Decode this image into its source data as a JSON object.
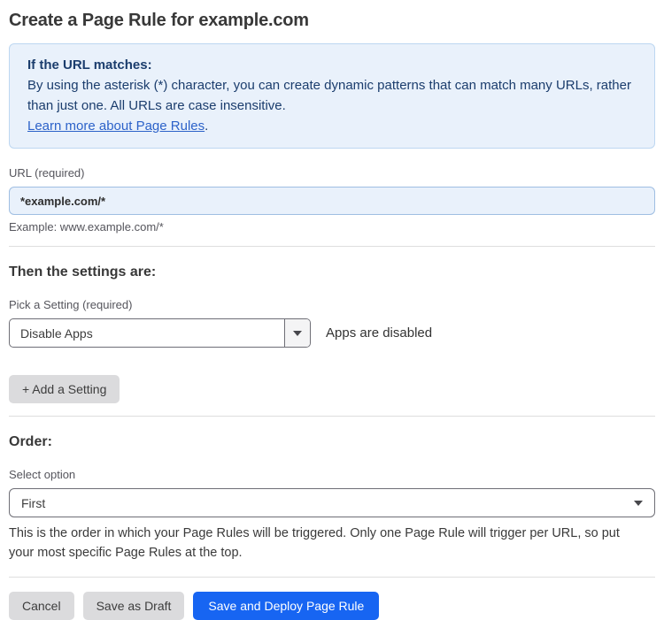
{
  "page": {
    "title": "Create a Page Rule for example.com"
  },
  "info_box": {
    "heading": "If the URL matches:",
    "body": "By using the asterisk (*) character, you can create dynamic patterns that can match many URLs, rather than just one. All URLs are case insensitive.",
    "link_label": "Learn more about Page Rules",
    "link_suffix": "."
  },
  "url_field": {
    "label": "URL (required)",
    "value": "*example.com/*",
    "helper": "Example: www.example.com/*"
  },
  "settings_section": {
    "heading": "Then the settings are:",
    "setting_label": "Pick a Setting (required)",
    "setting_value": "Disable Apps",
    "setting_status": "Apps are disabled",
    "add_setting_label": "+ Add a Setting"
  },
  "order_section": {
    "heading": "Order:",
    "select_label": "Select option",
    "select_value": "First",
    "help_text": "This is the order in which your Page Rules will be triggered. Only one Page Rule will trigger per URL, so put your most specific Page Rules at the top."
  },
  "footer": {
    "cancel_label": "Cancel",
    "save_draft_label": "Save as Draft",
    "save_deploy_label": "Save and Deploy Page Rule"
  },
  "colors": {
    "info_bg": "#E9F1FB",
    "info_border": "#BDD7F1",
    "info_text": "#1B3D6D",
    "link_blue": "#2C62C9",
    "input_bg": "#E9F1FB",
    "input_border": "#9FBEE2",
    "primary_button": "#1765F2",
    "gray_button": "#DBDBDD"
  }
}
